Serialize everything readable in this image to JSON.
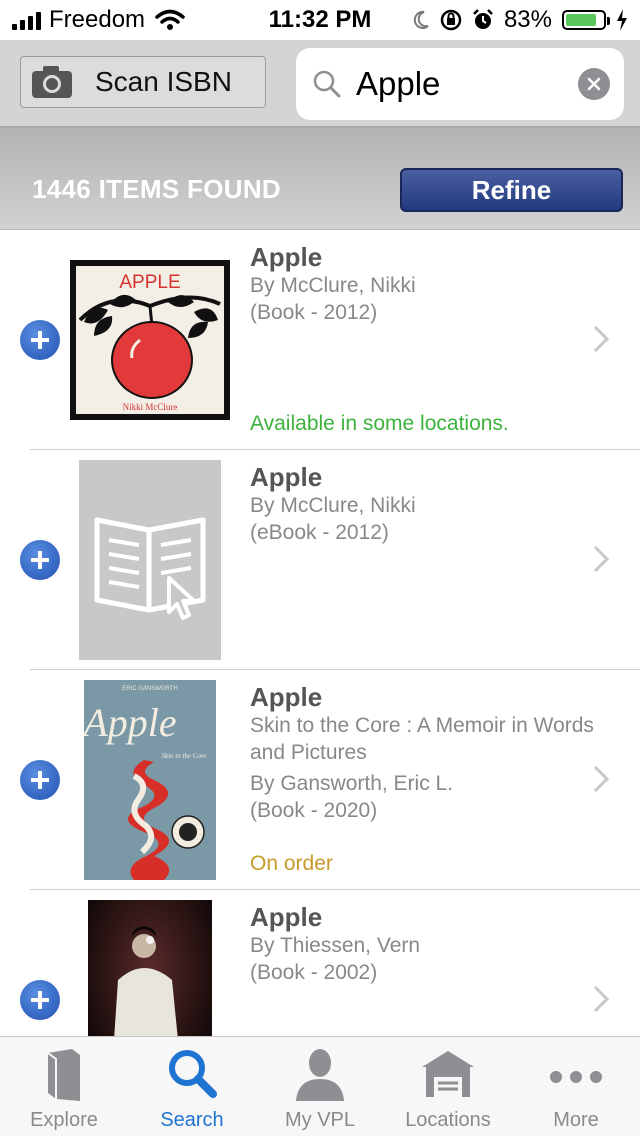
{
  "status_bar": {
    "carrier": "Freedom",
    "time": "11:32 PM",
    "battery": "83%",
    "battery_level": 0.83
  },
  "search": {
    "scan_label": "Scan ISBN",
    "query": "Apple"
  },
  "results": {
    "count_label": "1446 ITEMS FOUND",
    "refine_label": "Refine"
  },
  "items": [
    {
      "title": "Apple",
      "lines": [
        "By McClure, Nikki",
        "(Book - 2012)"
      ],
      "status": "Available in some locations.",
      "status_color": "#3db33d"
    },
    {
      "title": "Apple",
      "lines": [
        "By McClure, Nikki",
        "(eBook - 2012)"
      ],
      "status": ""
    },
    {
      "title": "Apple",
      "lines": [
        "Skin to the Core : A Memoir in Words",
        "and Pictures",
        "By Gansworth, Eric L.",
        "(Book - 2020)"
      ],
      "status": "On order",
      "status_color": "#c89a2a"
    },
    {
      "title": "Apple",
      "lines": [
        "By Thiessen, Vern",
        "(Book - 2002)"
      ],
      "status": ""
    }
  ],
  "covers": {
    "cover1_text": "APPLE",
    "cover1_author": "Nikki McClure",
    "cover3_title": "Apple",
    "cover3_subtitle": "Skin to the Core",
    "cover3_author": "ERIC GANSWORTH"
  },
  "tabs": [
    {
      "label": "Explore",
      "icon": "book-icon"
    },
    {
      "label": "Search",
      "icon": "search-icon",
      "active": true
    },
    {
      "label": "My VPL",
      "icon": "person-icon"
    },
    {
      "label": "Locations",
      "icon": "building-icon"
    },
    {
      "label": "More",
      "icon": "more-icon"
    }
  ],
  "colors": {
    "accent": "#1f73d1",
    "refine_button": "#2b3f86",
    "available": "#3db33d",
    "on_order": "#c89a2a"
  }
}
